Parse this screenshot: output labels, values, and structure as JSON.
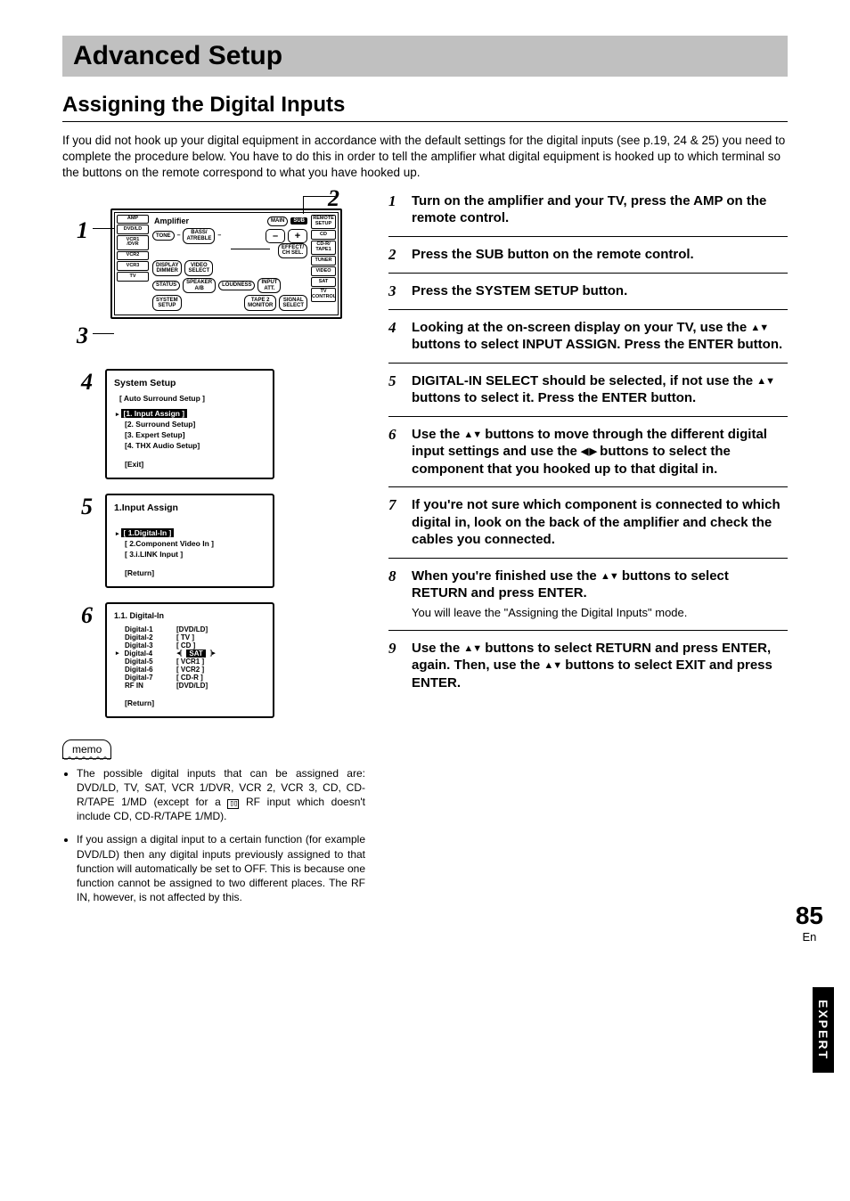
{
  "header": {
    "title": "Advanced Setup"
  },
  "section": {
    "title": "Assigning the Digital Inputs"
  },
  "intro": "If you did not hook up your digital equipment in accordance with the default settings for the digital inputs (see p.19, 24 & 25) you need to complete the procedure below. You have to do this in order to tell the amplifier what digital equipment is hooked up to which terminal so the buttons on the remote correspond to what you have hooked up.",
  "remote": {
    "callouts": {
      "one": "1",
      "two": "2",
      "three": "3"
    },
    "left_side": [
      "AMP",
      "DVD/LD",
      "VCR1\n/DVR",
      "VCR2",
      "VCR3",
      "TV"
    ],
    "right_side": [
      "REMOTE\nSETUP",
      "CD",
      "CD-R/\nTAPE1",
      "TUNER",
      "VIDEO",
      "SAT",
      "TV\nCONTROL"
    ],
    "amp_label": "Amplifier",
    "main_label": "MAIN",
    "sub_label": "SUB",
    "tone": "TONE",
    "bass": "BASS/\nATREBLE",
    "minus": "–",
    "plus": "+",
    "effect": "EFFECT/\nCH SEL.",
    "row3": [
      "DISPLAY\nDIMMER",
      "VIDEO\nSELECT"
    ],
    "row4": [
      "STATUS",
      "SPEAKER\nA/B",
      "LOUDNESS",
      "INPUT\nATT."
    ],
    "row5": [
      "SYSTEM\nSETUP",
      "TAPE 2\nMONITOR",
      "SIGNAL\nSELECT"
    ]
  },
  "osd4": {
    "num": "4",
    "title": "System Setup",
    "sub": "[ Auto Surround Setup ]",
    "items": [
      "[1. Input Assign ]",
      "[2. Surround Setup]",
      "[3. Expert Setup]",
      "[4. THX Audio Setup]"
    ],
    "exit": "[Exit]"
  },
  "osd5": {
    "num": "5",
    "title": "1.Input Assign",
    "items": [
      "[ 1.Digital-In ]",
      "[ 2.Component Video In ]",
      "[ 3.i.LINK Input ]"
    ],
    "exit": "[Return]"
  },
  "osd6": {
    "num": "6",
    "title": "1.1. Digital-In",
    "rows": [
      {
        "k": "Digital-1",
        "v": "[DVD/LD]"
      },
      {
        "k": "Digital-2",
        "v": "[   TV   ]"
      },
      {
        "k": "Digital-3",
        "v": "[   CD   ]"
      },
      {
        "k": "Digital-4",
        "v": "SAT",
        "sel": true
      },
      {
        "k": "Digital-5",
        "v": "[ VCR1 ]"
      },
      {
        "k": "Digital-6",
        "v": "[ VCR2 ]"
      },
      {
        "k": "Digital-7",
        "v": "[ CD-R ]"
      },
      {
        "k": "RF  IN",
        "v": "[DVD/LD]"
      }
    ],
    "exit": "[Return]"
  },
  "memo": {
    "label": "memo",
    "b1_a": "The possible digital inputs that can be assigned are: DVD/LD, TV, SAT, VCR 1/DVR, VCR 2, VCR 3, CD, CD-R/TAPE 1/MD (except for a ",
    "b1_b": " RF input which  doesn't include CD, CD-R/TAPE 1/MD).",
    "b2": "If you assign a digital input to a certain function (for example DVD/LD) then any digital inputs previously assigned to that function will automatically be set to OFF. This is because one function cannot be assigned to two different places. The RF IN, however, is not affected by this."
  },
  "steps": {
    "s1": {
      "n": "1",
      "t": "Turn on the amplifier and your TV, press the AMP on the remote control."
    },
    "s2": {
      "n": "2",
      "t": "Press the SUB button on the remote control."
    },
    "s3": {
      "n": "3",
      "t": "Press the SYSTEM SETUP button."
    },
    "s4": {
      "n": "4",
      "t_a": "Looking at the on-screen display on your TV, use the ",
      "t_b": " buttons to select INPUT ASSIGN.  Press the ENTER button."
    },
    "s5": {
      "n": "5",
      "t_a": "DIGITAL-IN SELECT should be selected, if not use the ",
      "t_b": " buttons to select it. Press the ENTER button."
    },
    "s6": {
      "n": "6",
      "t_a": "Use the ",
      "t_b": " buttons to move through the different digital input settings and use the ",
      "t_c": " buttons to select the component that you hooked up to that digital in."
    },
    "s7": {
      "n": "7",
      "t": "If you're not sure which component is connected to which digital in, look on the back of the amplifier and check the cables you connected."
    },
    "s8": {
      "n": "8",
      "t_a": "When you're finished use the ",
      "t_b": " buttons to select RETURN and press ENTER.",
      "sub": "You will leave the \"Assigning the Digital Inputs\" mode."
    },
    "s9": {
      "n": "9",
      "t_a": "Use the ",
      "t_b": " buttons to select RETURN and press ENTER, again. Then, use the ",
      "t_c": " buttons to select EXIT and press ENTER."
    }
  },
  "side_tab": "EXPERT",
  "page": {
    "num": "85",
    "lang": "En"
  },
  "glyph": {
    "updown": "▲▼",
    "leftright": "◀ ▶",
    "dolby": "▯▯"
  }
}
